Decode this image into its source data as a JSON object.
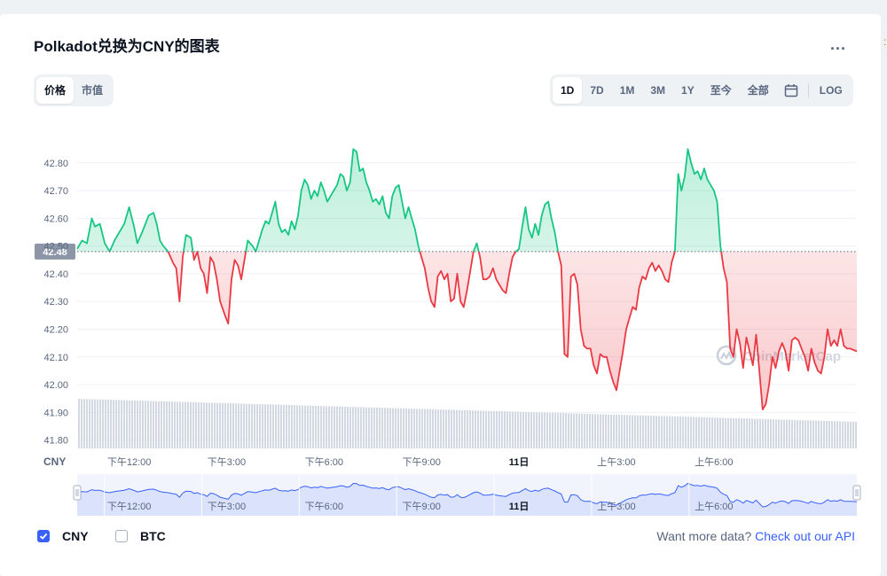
{
  "title": "Polkadot兑换为CNY的图表",
  "menu_glyph": "...",
  "mode_tabs": [
    {
      "label": "价格",
      "active": true
    },
    {
      "label": "市值",
      "active": false
    }
  ],
  "range_tabs": [
    {
      "label": "1D",
      "active": true
    },
    {
      "label": "7D",
      "active": false
    },
    {
      "label": "1M",
      "active": false
    },
    {
      "label": "3M",
      "active": false
    },
    {
      "label": "1Y",
      "active": false
    },
    {
      "label": "至今",
      "active": false
    },
    {
      "label": "全部",
      "active": false
    }
  ],
  "log_label": "LOG",
  "icons": {
    "menu": "more-icon",
    "calendar": "calendar-icon",
    "check": "check-icon",
    "watermark": "coinmarketcap-logo-icon"
  },
  "watermark": "CoinMarketCap",
  "legend": [
    {
      "label": "CNY",
      "checked": true
    },
    {
      "label": "BTC",
      "checked": false
    }
  ],
  "api": {
    "prefix": "Want more data?",
    "link": "Check out our API"
  },
  "colors": {
    "up": "#16c784",
    "down": "#ea3943",
    "accent": "#3861fb",
    "volume": "#cfd6e4",
    "navigator": "#dbe2fb"
  },
  "chart_data": {
    "type": "line",
    "currency_label": "CNY",
    "baseline": 42.48,
    "baseline_label": "42.48",
    "ylim": [
      41.77,
      42.94
    ],
    "yticks": [
      "42.80",
      "42.70",
      "42.60",
      "42.50",
      "42.40",
      "42.30",
      "42.20",
      "42.10",
      "42.00",
      "41.90",
      "41.80"
    ],
    "xticks": [
      {
        "t": 1.6,
        "label": "下午12:00",
        "bold": false
      },
      {
        "t": 4.6,
        "label": "下午3:00",
        "bold": false
      },
      {
        "t": 7.6,
        "label": "下午6:00",
        "bold": false
      },
      {
        "t": 10.6,
        "label": "下午9:00",
        "bold": false
      },
      {
        "t": 13.6,
        "label": "11日",
        "bold": true
      },
      {
        "t": 16.6,
        "label": "上午3:00",
        "bold": false
      },
      {
        "t": 19.6,
        "label": "上午6:00",
        "bold": false
      }
    ],
    "xlim": [
      0,
      24
    ],
    "series": [
      {
        "values": [
          [
            0.0,
            42.49
          ],
          [
            0.15,
            42.52
          ],
          [
            0.3,
            42.51
          ],
          [
            0.45,
            42.6
          ],
          [
            0.55,
            42.57
          ],
          [
            0.7,
            42.58
          ],
          [
            0.85,
            42.51
          ],
          [
            1.0,
            42.48
          ],
          [
            1.15,
            42.52
          ],
          [
            1.3,
            42.55
          ],
          [
            1.45,
            42.58
          ],
          [
            1.6,
            42.64
          ],
          [
            1.75,
            42.57
          ],
          [
            1.85,
            42.51
          ],
          [
            2.0,
            42.55
          ],
          [
            2.2,
            42.61
          ],
          [
            2.35,
            42.62
          ],
          [
            2.45,
            42.58
          ],
          [
            2.55,
            42.52
          ],
          [
            2.65,
            42.5
          ],
          [
            2.8,
            42.48
          ],
          [
            2.95,
            42.44
          ],
          [
            3.05,
            42.42
          ],
          [
            3.15,
            42.3
          ],
          [
            3.25,
            42.46
          ],
          [
            3.35,
            42.54
          ],
          [
            3.5,
            42.53
          ],
          [
            3.6,
            42.45
          ],
          [
            3.7,
            42.48
          ],
          [
            3.8,
            42.42
          ],
          [
            3.9,
            42.4
          ],
          [
            4.0,
            42.33
          ],
          [
            4.1,
            42.46
          ],
          [
            4.2,
            42.44
          ],
          [
            4.3,
            42.38
          ],
          [
            4.4,
            42.3
          ],
          [
            4.55,
            42.25
          ],
          [
            4.65,
            42.22
          ],
          [
            4.75,
            42.38
          ],
          [
            4.85,
            42.45
          ],
          [
            4.95,
            42.43
          ],
          [
            5.05,
            42.38
          ],
          [
            5.15,
            42.45
          ],
          [
            5.25,
            42.52
          ],
          [
            5.4,
            42.5
          ],
          [
            5.5,
            42.48
          ],
          [
            5.6,
            42.52
          ],
          [
            5.7,
            42.56
          ],
          [
            5.8,
            42.59
          ],
          [
            5.9,
            42.58
          ],
          [
            6.0,
            42.62
          ],
          [
            6.1,
            42.66
          ],
          [
            6.2,
            42.58
          ],
          [
            6.3,
            42.55
          ],
          [
            6.4,
            42.56
          ],
          [
            6.5,
            42.54
          ],
          [
            6.6,
            42.59
          ],
          [
            6.7,
            42.56
          ],
          [
            6.8,
            42.61
          ],
          [
            6.9,
            42.7
          ],
          [
            7.0,
            42.74
          ],
          [
            7.1,
            42.72
          ],
          [
            7.2,
            42.67
          ],
          [
            7.3,
            42.7
          ],
          [
            7.4,
            42.68
          ],
          [
            7.5,
            42.73
          ],
          [
            7.6,
            42.7
          ],
          [
            7.7,
            42.66
          ],
          [
            7.8,
            42.68
          ],
          [
            7.9,
            42.7
          ],
          [
            8.0,
            42.72
          ],
          [
            8.1,
            42.76
          ],
          [
            8.2,
            42.75
          ],
          [
            8.3,
            42.7
          ],
          [
            8.4,
            42.73
          ],
          [
            8.5,
            42.85
          ],
          [
            8.6,
            42.84
          ],
          [
            8.7,
            42.77
          ],
          [
            8.8,
            42.78
          ],
          [
            8.9,
            42.73
          ],
          [
            9.0,
            42.7
          ],
          [
            9.1,
            42.66
          ],
          [
            9.2,
            42.67
          ],
          [
            9.3,
            42.65
          ],
          [
            9.4,
            42.68
          ],
          [
            9.5,
            42.62
          ],
          [
            9.6,
            42.6
          ],
          [
            9.7,
            42.68
          ],
          [
            9.8,
            42.71
          ],
          [
            9.9,
            42.72
          ],
          [
            10.0,
            42.66
          ],
          [
            10.1,
            42.6
          ],
          [
            10.2,
            42.64
          ],
          [
            10.3,
            42.6
          ],
          [
            10.4,
            42.56
          ],
          [
            10.5,
            42.5
          ],
          [
            10.6,
            42.46
          ],
          [
            10.7,
            42.42
          ],
          [
            10.8,
            42.35
          ],
          [
            10.9,
            42.3
          ],
          [
            11.0,
            42.28
          ],
          [
            11.1,
            42.39
          ],
          [
            11.2,
            42.41
          ],
          [
            11.3,
            42.38
          ],
          [
            11.4,
            42.4
          ],
          [
            11.5,
            42.3
          ],
          [
            11.6,
            42.31
          ],
          [
            11.7,
            42.4
          ],
          [
            11.8,
            42.3
          ],
          [
            11.9,
            42.28
          ],
          [
            12.0,
            42.34
          ],
          [
            12.1,
            42.41
          ],
          [
            12.2,
            42.48
          ],
          [
            12.3,
            42.51
          ],
          [
            12.4,
            42.46
          ],
          [
            12.5,
            42.38
          ],
          [
            12.6,
            42.38
          ],
          [
            12.7,
            42.39
          ],
          [
            12.8,
            42.42
          ],
          [
            12.9,
            42.38
          ],
          [
            13.0,
            42.36
          ],
          [
            13.1,
            42.34
          ],
          [
            13.2,
            42.33
          ],
          [
            13.3,
            42.4
          ],
          [
            13.4,
            42.46
          ],
          [
            13.5,
            42.48
          ],
          [
            13.6,
            42.49
          ],
          [
            13.7,
            42.57
          ],
          [
            13.8,
            42.64
          ],
          [
            13.9,
            42.56
          ],
          [
            14.0,
            42.53
          ],
          [
            14.1,
            42.58
          ],
          [
            14.2,
            42.54
          ],
          [
            14.3,
            42.61
          ],
          [
            14.4,
            42.65
          ],
          [
            14.5,
            42.66
          ],
          [
            14.6,
            42.6
          ],
          [
            14.7,
            42.55
          ],
          [
            14.8,
            42.48
          ],
          [
            14.9,
            42.43
          ],
          [
            15.0,
            42.11
          ],
          [
            15.1,
            42.1
          ],
          [
            15.2,
            42.39
          ],
          [
            15.3,
            42.4
          ],
          [
            15.4,
            42.36
          ],
          [
            15.5,
            42.2
          ],
          [
            15.6,
            42.14
          ],
          [
            15.7,
            42.13
          ],
          [
            15.8,
            42.13
          ],
          [
            15.9,
            42.07
          ],
          [
            16.0,
            42.04
          ],
          [
            16.1,
            42.11
          ],
          [
            16.2,
            42.1
          ],
          [
            16.3,
            42.1
          ],
          [
            16.4,
            42.05
          ],
          [
            16.5,
            42.01
          ],
          [
            16.6,
            41.98
          ],
          [
            16.7,
            42.05
          ],
          [
            16.8,
            42.12
          ],
          [
            16.9,
            42.2
          ],
          [
            17.0,
            42.24
          ],
          [
            17.1,
            42.28
          ],
          [
            17.2,
            42.27
          ],
          [
            17.3,
            42.35
          ],
          [
            17.4,
            42.39
          ],
          [
            17.5,
            42.38
          ],
          [
            17.6,
            42.42
          ],
          [
            17.7,
            42.44
          ],
          [
            17.8,
            42.41
          ],
          [
            17.9,
            42.43
          ],
          [
            18.0,
            42.41
          ],
          [
            18.1,
            42.38
          ],
          [
            18.2,
            42.37
          ],
          [
            18.3,
            42.44
          ],
          [
            18.4,
            42.48
          ],
          [
            18.5,
            42.76
          ],
          [
            18.6,
            42.7
          ],
          [
            18.7,
            42.75
          ],
          [
            18.8,
            42.85
          ],
          [
            18.9,
            42.8
          ],
          [
            19.0,
            42.76
          ],
          [
            19.1,
            42.77
          ],
          [
            19.2,
            42.74
          ],
          [
            19.3,
            42.78
          ],
          [
            19.4,
            42.74
          ],
          [
            19.5,
            42.72
          ],
          [
            19.6,
            42.7
          ],
          [
            19.7,
            42.66
          ],
          [
            19.8,
            42.5
          ],
          [
            19.9,
            42.42
          ],
          [
            20.0,
            42.37
          ],
          [
            20.1,
            42.13
          ],
          [
            20.2,
            42.1
          ],
          [
            20.3,
            42.2
          ],
          [
            20.4,
            42.15
          ],
          [
            20.5,
            42.06
          ],
          [
            20.6,
            42.17
          ],
          [
            20.7,
            42.12
          ],
          [
            20.8,
            42.07
          ],
          [
            20.9,
            42.18
          ],
          [
            21.0,
            42.05
          ],
          [
            21.1,
            41.91
          ],
          [
            21.2,
            41.93
          ],
          [
            21.3,
            42.0
          ],
          [
            21.4,
            42.1
          ],
          [
            21.5,
            42.06
          ],
          [
            21.6,
            42.12
          ],
          [
            21.7,
            42.15
          ],
          [
            21.8,
            42.12
          ],
          [
            21.9,
            42.05
          ],
          [
            22.0,
            42.16
          ],
          [
            22.1,
            42.17
          ],
          [
            22.2,
            42.16
          ],
          [
            22.3,
            42.13
          ],
          [
            22.4,
            42.1
          ],
          [
            22.5,
            42.05
          ],
          [
            22.6,
            42.13
          ],
          [
            22.7,
            42.08
          ],
          [
            22.8,
            42.05
          ],
          [
            22.9,
            42.04
          ],
          [
            23.0,
            42.1
          ],
          [
            23.1,
            42.2
          ],
          [
            23.2,
            42.14
          ],
          [
            23.3,
            42.16
          ],
          [
            23.4,
            42.14
          ],
          [
            23.5,
            42.2
          ],
          [
            23.6,
            42.14
          ],
          [
            23.7,
            42.13
          ],
          [
            23.8,
            42.13
          ],
          [
            24.0,
            42.12
          ]
        ]
      }
    ],
    "navigator": {
      "xticks_repeat": true,
      "handle_icon": "navigator-handle-icon"
    }
  }
}
